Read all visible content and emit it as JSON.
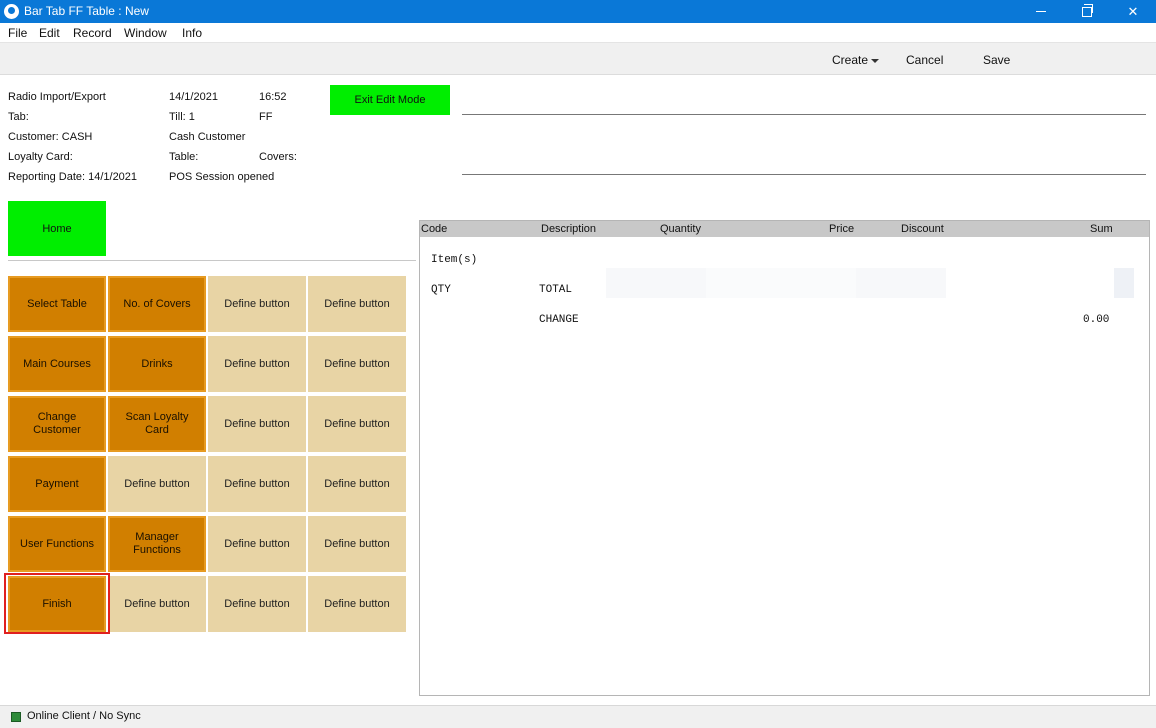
{
  "window": {
    "title": "Bar Tab FF Table : New",
    "minimize_glyph": "",
    "maximize_glyph": "",
    "close_glyph": "✕"
  },
  "menu": [
    "File",
    "Edit",
    "Record",
    "Window",
    "Info"
  ],
  "toolbar": {
    "create": "Create",
    "cancel": "Cancel",
    "save": "Save"
  },
  "header": {
    "company": "Radio Import/Export",
    "date": "14/1/2021",
    "time": "16:52",
    "tab": "Tab:",
    "till": "Till: 1",
    "ff": "FF",
    "customer": "Customer: CASH",
    "customer_name": "Cash Customer",
    "loyalty": "Loyalty Card:",
    "table": "Table:",
    "covers": "Covers:",
    "reporting_date": "Reporting Date: 14/1/2021",
    "session": "POS Session opened"
  },
  "buttons": {
    "exit_edit_mode": "Exit Edit Mode",
    "home": "Home"
  },
  "grid": [
    [
      "Select Table",
      "No. of  Covers",
      "Define button",
      "Define button"
    ],
    [
      "Main Courses",
      "Drinks",
      "Define button",
      "Define button"
    ],
    [
      "Change Customer",
      "Scan Loyalty Card",
      "Define button",
      "Define button"
    ],
    [
      "Payment",
      "Define button",
      "Define button",
      "Define button"
    ],
    [
      "User Functions",
      "Manager Functions",
      "Define button",
      "Define button"
    ],
    [
      "Finish",
      "Define button",
      "Define button",
      "Define button"
    ]
  ],
  "table": {
    "columns": [
      "Code",
      "Description",
      "Quantity",
      "Price",
      "Discount",
      "Sum"
    ],
    "items_label": "Item(s)",
    "qty_label": "QTY",
    "total_label": "TOTAL",
    "change_label": "CHANGE",
    "change_value": "0.00"
  },
  "status": {
    "text": "Online Client / No Sync",
    "indicator_color": "#2e8b3a"
  },
  "colors": {
    "title_bar": "#0a78d7",
    "green_button": "#00ee00",
    "active_button": "#d17f00",
    "define_button": "#e8d4a5",
    "highlight": "#e02020"
  }
}
